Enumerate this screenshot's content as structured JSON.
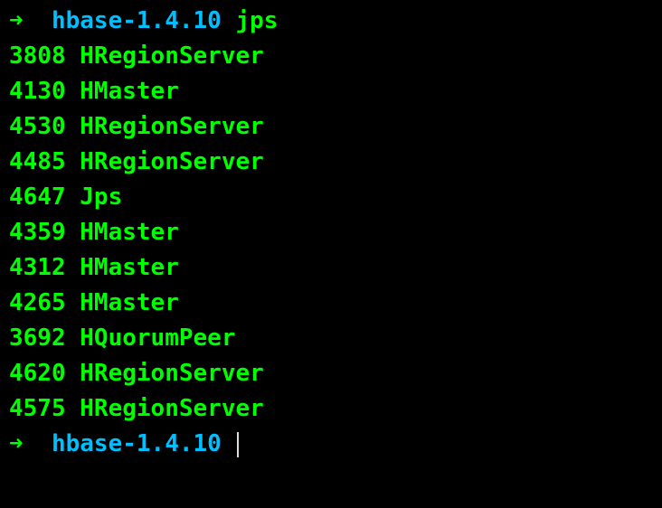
{
  "prompt": {
    "arrow": "➜",
    "directory": "hbase-1.4.10",
    "command": "jps"
  },
  "processes": [
    {
      "pid": "3808",
      "name": "HRegionServer"
    },
    {
      "pid": "4130",
      "name": "HMaster"
    },
    {
      "pid": "4530",
      "name": "HRegionServer"
    },
    {
      "pid": "4485",
      "name": "HRegionServer"
    },
    {
      "pid": "4647",
      "name": "Jps"
    },
    {
      "pid": "4359",
      "name": "HMaster"
    },
    {
      "pid": "4312",
      "name": "HMaster"
    },
    {
      "pid": "4265",
      "name": "HMaster"
    },
    {
      "pid": "3692",
      "name": "HQuorumPeer"
    },
    {
      "pid": "4620",
      "name": "HRegionServer"
    },
    {
      "pid": "4575",
      "name": "HRegionServer"
    }
  ],
  "prompt2": {
    "arrow": "➜",
    "directory": "hbase-1.4.10"
  }
}
